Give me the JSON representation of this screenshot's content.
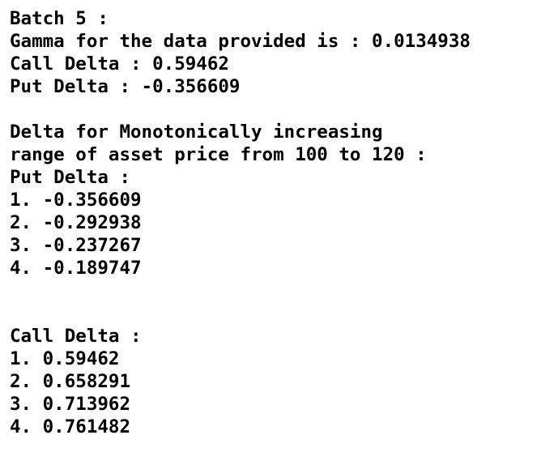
{
  "output": {
    "batch_line": "Batch 5 :",
    "gamma_line": "Gamma for the data provided is : 0.0134938",
    "call_delta_line": "Call Delta : 0.59462",
    "put_delta_line": "Put Delta : -0.356609",
    "range_heading_1": "Delta for Monotonically increasing",
    "range_heading_2": "range of asset price from 100 to 120 :",
    "put_section": {
      "heading": "Put Delta :",
      "items": [
        "1. -0.356609",
        "2. -0.292938",
        "3. -0.237267",
        "4. -0.189747"
      ]
    },
    "call_section": {
      "heading": "Call Delta :",
      "items": [
        "1. 0.59462",
        "2. 0.658291",
        "3. 0.713962",
        "4. 0.761482"
      ]
    }
  }
}
